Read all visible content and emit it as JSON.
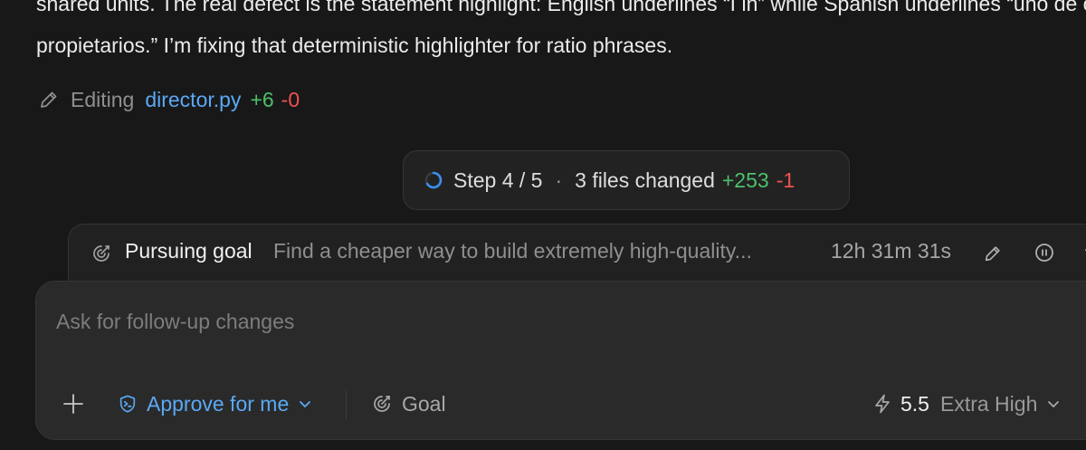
{
  "message": {
    "line1": "shared units. The real defect is the statement highlight: English underlines “I in” while Spanish underlines “uno de cada",
    "line2": "propietarios.” I’m fixing that deterministic highlighter for ratio phrases."
  },
  "edit_status": {
    "icon": "pencil-icon",
    "label": "Editing",
    "file": "director.py",
    "additions": "+6",
    "deletions": "-0"
  },
  "step_status": {
    "icon": "spinner-icon",
    "step": "Step 4 / 5",
    "separator": "·",
    "files_changed": "3 files changed",
    "additions": "+253",
    "deletions": "-1"
  },
  "goal_banner": {
    "icon": "goal-icon",
    "title": "Pursuing goal",
    "description": "Find a cheaper way to build extremely high-quality...",
    "elapsed": "12h 31m 31s",
    "actions": [
      "pencil-icon",
      "pause-icon",
      "chevron-down-icon"
    ]
  },
  "composer": {
    "placeholder": "Ask for follow-up changes",
    "value": ""
  },
  "toolbar": {
    "add_icon": "plus-icon",
    "approval_mode": "Approve for me",
    "approval_icon": "shield-terminal-icon",
    "goal_label": "Goal",
    "goal_icon": "goal-icon",
    "model_icon": "lightning-icon",
    "model_version": "5.5",
    "reasoning_effort": "Extra High"
  },
  "colors": {
    "background": "#181818",
    "link_blue": "#5aa9f5",
    "addition_green": "#4cc06b",
    "deletion_red": "#ef5350",
    "composer_bg": "#2a2a2a"
  }
}
